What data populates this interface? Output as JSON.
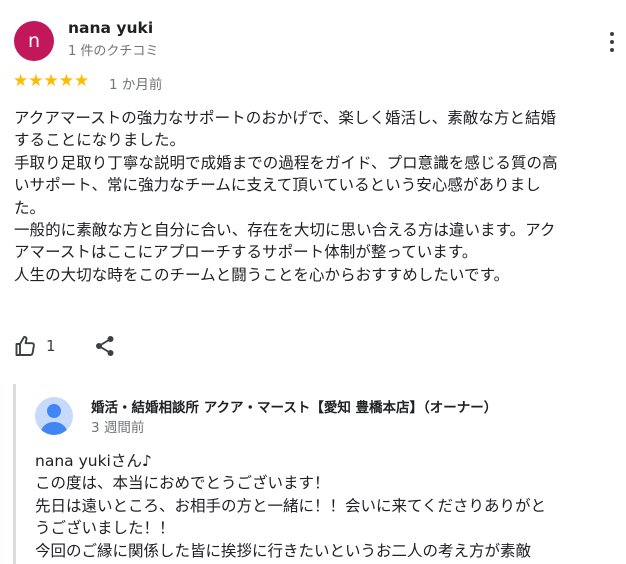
{
  "review": {
    "avatar_letter": "n",
    "avatar_color": "#c2185b",
    "reviewer_name": "nana yuki",
    "review_count": "1 件のクチコミ",
    "rating": 5,
    "star_color": "#fbbc04",
    "date": "1 か月前",
    "text": "アクアマーストの強力なサポートのおかげで、楽しく婚活し、素敵な方と結婚\nすることになりました。\n手取り足取り丁寧な説明で成婚までの過程をガイド、プロ意識を感じる質の高\nいサポート、常に強力なチームに支えて頂いているという安心感がありまし\nた。\n一般的に素敵な方と自分に合い、存在を大切に思い合える方は違います。アク\nアマーストはここにアプローチするサポート体制が整っています。\n人生の大切な時をこのチームと闘うことを心からおすすめしたいです。",
    "like_count": "1"
  },
  "owner_reply": {
    "name": "婚活・結婚相談所 アクア・マースト【愛知 豊橋本店】（オーナー）",
    "date": "3 週間前",
    "text": "nana yukiさん♪\nこの度は、本当におめでとうございます！\n先日は遠いところ、お相手の方と一緒に！！会いに来てくださりありがと\nうございました！！\n今回のご縁に関係した皆に挨拶に行きたいというお二人の考え方が素敵"
  },
  "icons": {
    "more": "more-vert-icon",
    "like": "thumb-up-icon",
    "share": "share-icon",
    "owner_avatar": "person-icon"
  }
}
